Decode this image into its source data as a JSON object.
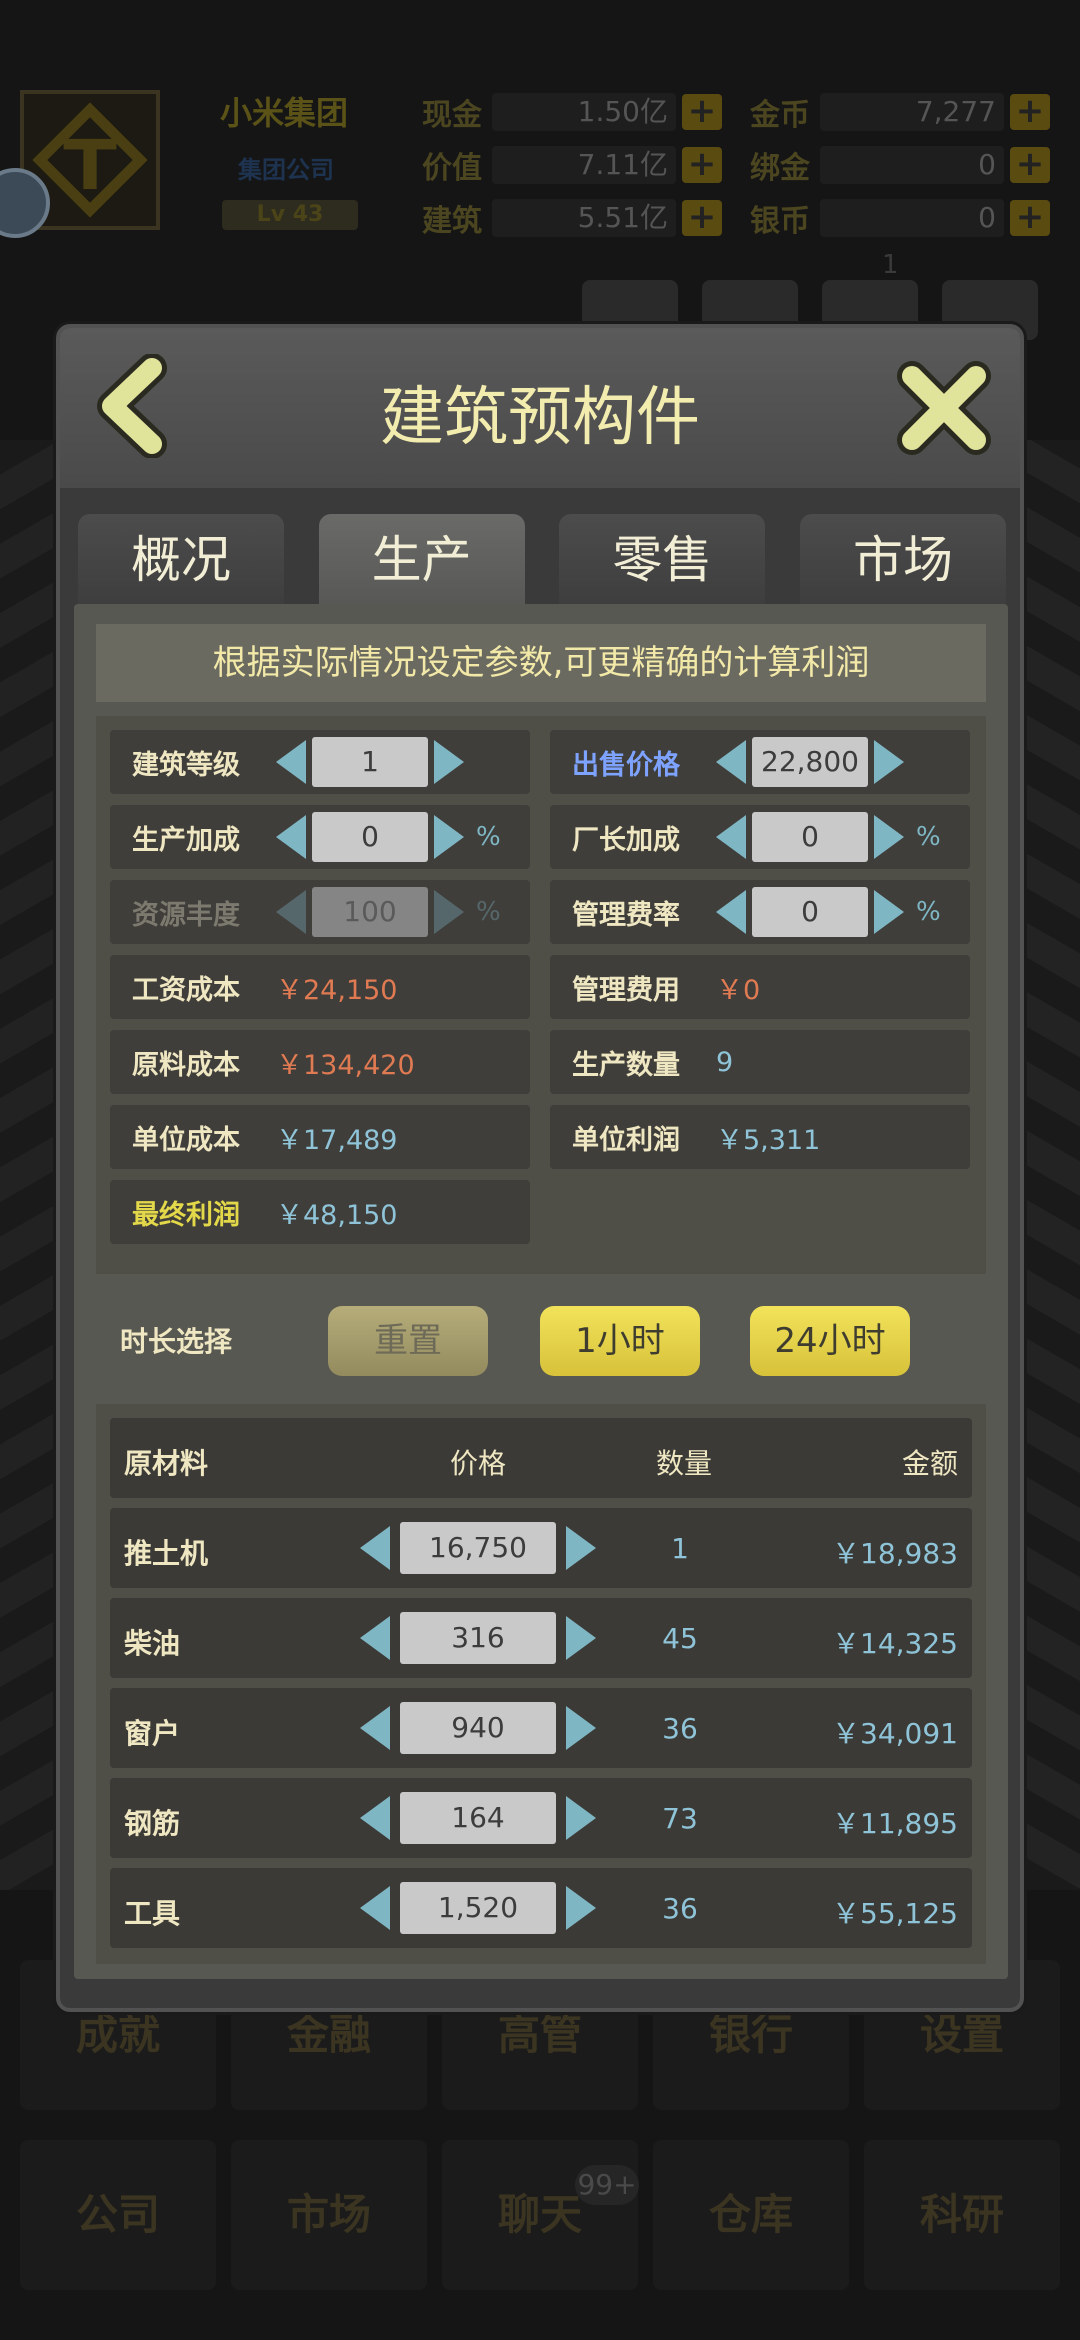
{
  "hud": {
    "company_name": "小米集团",
    "company_type": "集团公司",
    "level": "Lv 43",
    "stats": [
      {
        "label": "现金",
        "value": "1.50亿"
      },
      {
        "label": "价值",
        "value": "7.11亿"
      },
      {
        "label": "建筑",
        "value": "5.51亿"
      },
      {
        "label": "金币",
        "value": "7,277"
      },
      {
        "label": "绑金",
        "value": "0"
      },
      {
        "label": "银币",
        "value": "0"
      }
    ],
    "plus": "+",
    "notif_count": "1"
  },
  "bottom_menu": {
    "row1": [
      "成就",
      "金融",
      "高管",
      "银行",
      "设置"
    ],
    "row2": [
      "公司",
      "市场",
      "聊天",
      "仓库",
      "科研"
    ],
    "chat_badge": "99+"
  },
  "dialog": {
    "title": "建筑预构件",
    "tabs": [
      "概况",
      "生产",
      "零售",
      "市场"
    ],
    "active_tab": 1,
    "hint": "根据实际情况设定参数,可更精确的计算利润",
    "params": {
      "level": {
        "label": "建筑等级",
        "value": "1"
      },
      "sale_price": {
        "label": "出售价格",
        "value": "22,800"
      },
      "prod_bonus": {
        "label": "生产加成",
        "value": "0",
        "unit": "%"
      },
      "manager_bonus": {
        "label": "厂长加成",
        "value": "0",
        "unit": "%"
      },
      "resource": {
        "label": "资源丰度",
        "value": "100",
        "unit": "%"
      },
      "mgmt_rate": {
        "label": "管理费率",
        "value": "0",
        "unit": "%"
      },
      "wage_cost": {
        "label": "工资成本",
        "value": "￥24,150"
      },
      "mgmt_fee": {
        "label": "管理费用",
        "value": "￥0"
      },
      "material_cost": {
        "label": "原料成本",
        "value": "￥134,420"
      },
      "output_qty": {
        "label": "生产数量",
        "value": "9"
      },
      "unit_cost": {
        "label": "单位成本",
        "value": "￥17,489"
      },
      "unit_profit": {
        "label": "单位利润",
        "value": "￥5,311"
      },
      "final_profit": {
        "label": "最终利润",
        "value": "￥48,150"
      }
    },
    "duration": {
      "label": "时长选择",
      "reset": "重置",
      "one_hour": "1小时",
      "day": "24小时"
    },
    "materials": {
      "headers": {
        "name": "原材料",
        "price": "价格",
        "qty": "数量",
        "amount": "金额"
      },
      "rows": [
        {
          "name": "推土机",
          "price": "16,750",
          "qty": "1",
          "amount": "￥18,983"
        },
        {
          "name": "柴油",
          "price": "316",
          "qty": "45",
          "amount": "￥14,325"
        },
        {
          "name": "窗户",
          "price": "940",
          "qty": "36",
          "amount": "￥34,091"
        },
        {
          "name": "钢筋",
          "price": "164",
          "qty": "73",
          "amount": "￥11,895"
        },
        {
          "name": "工具",
          "price": "1,520",
          "qty": "36",
          "amount": "￥55,125"
        }
      ]
    }
  }
}
